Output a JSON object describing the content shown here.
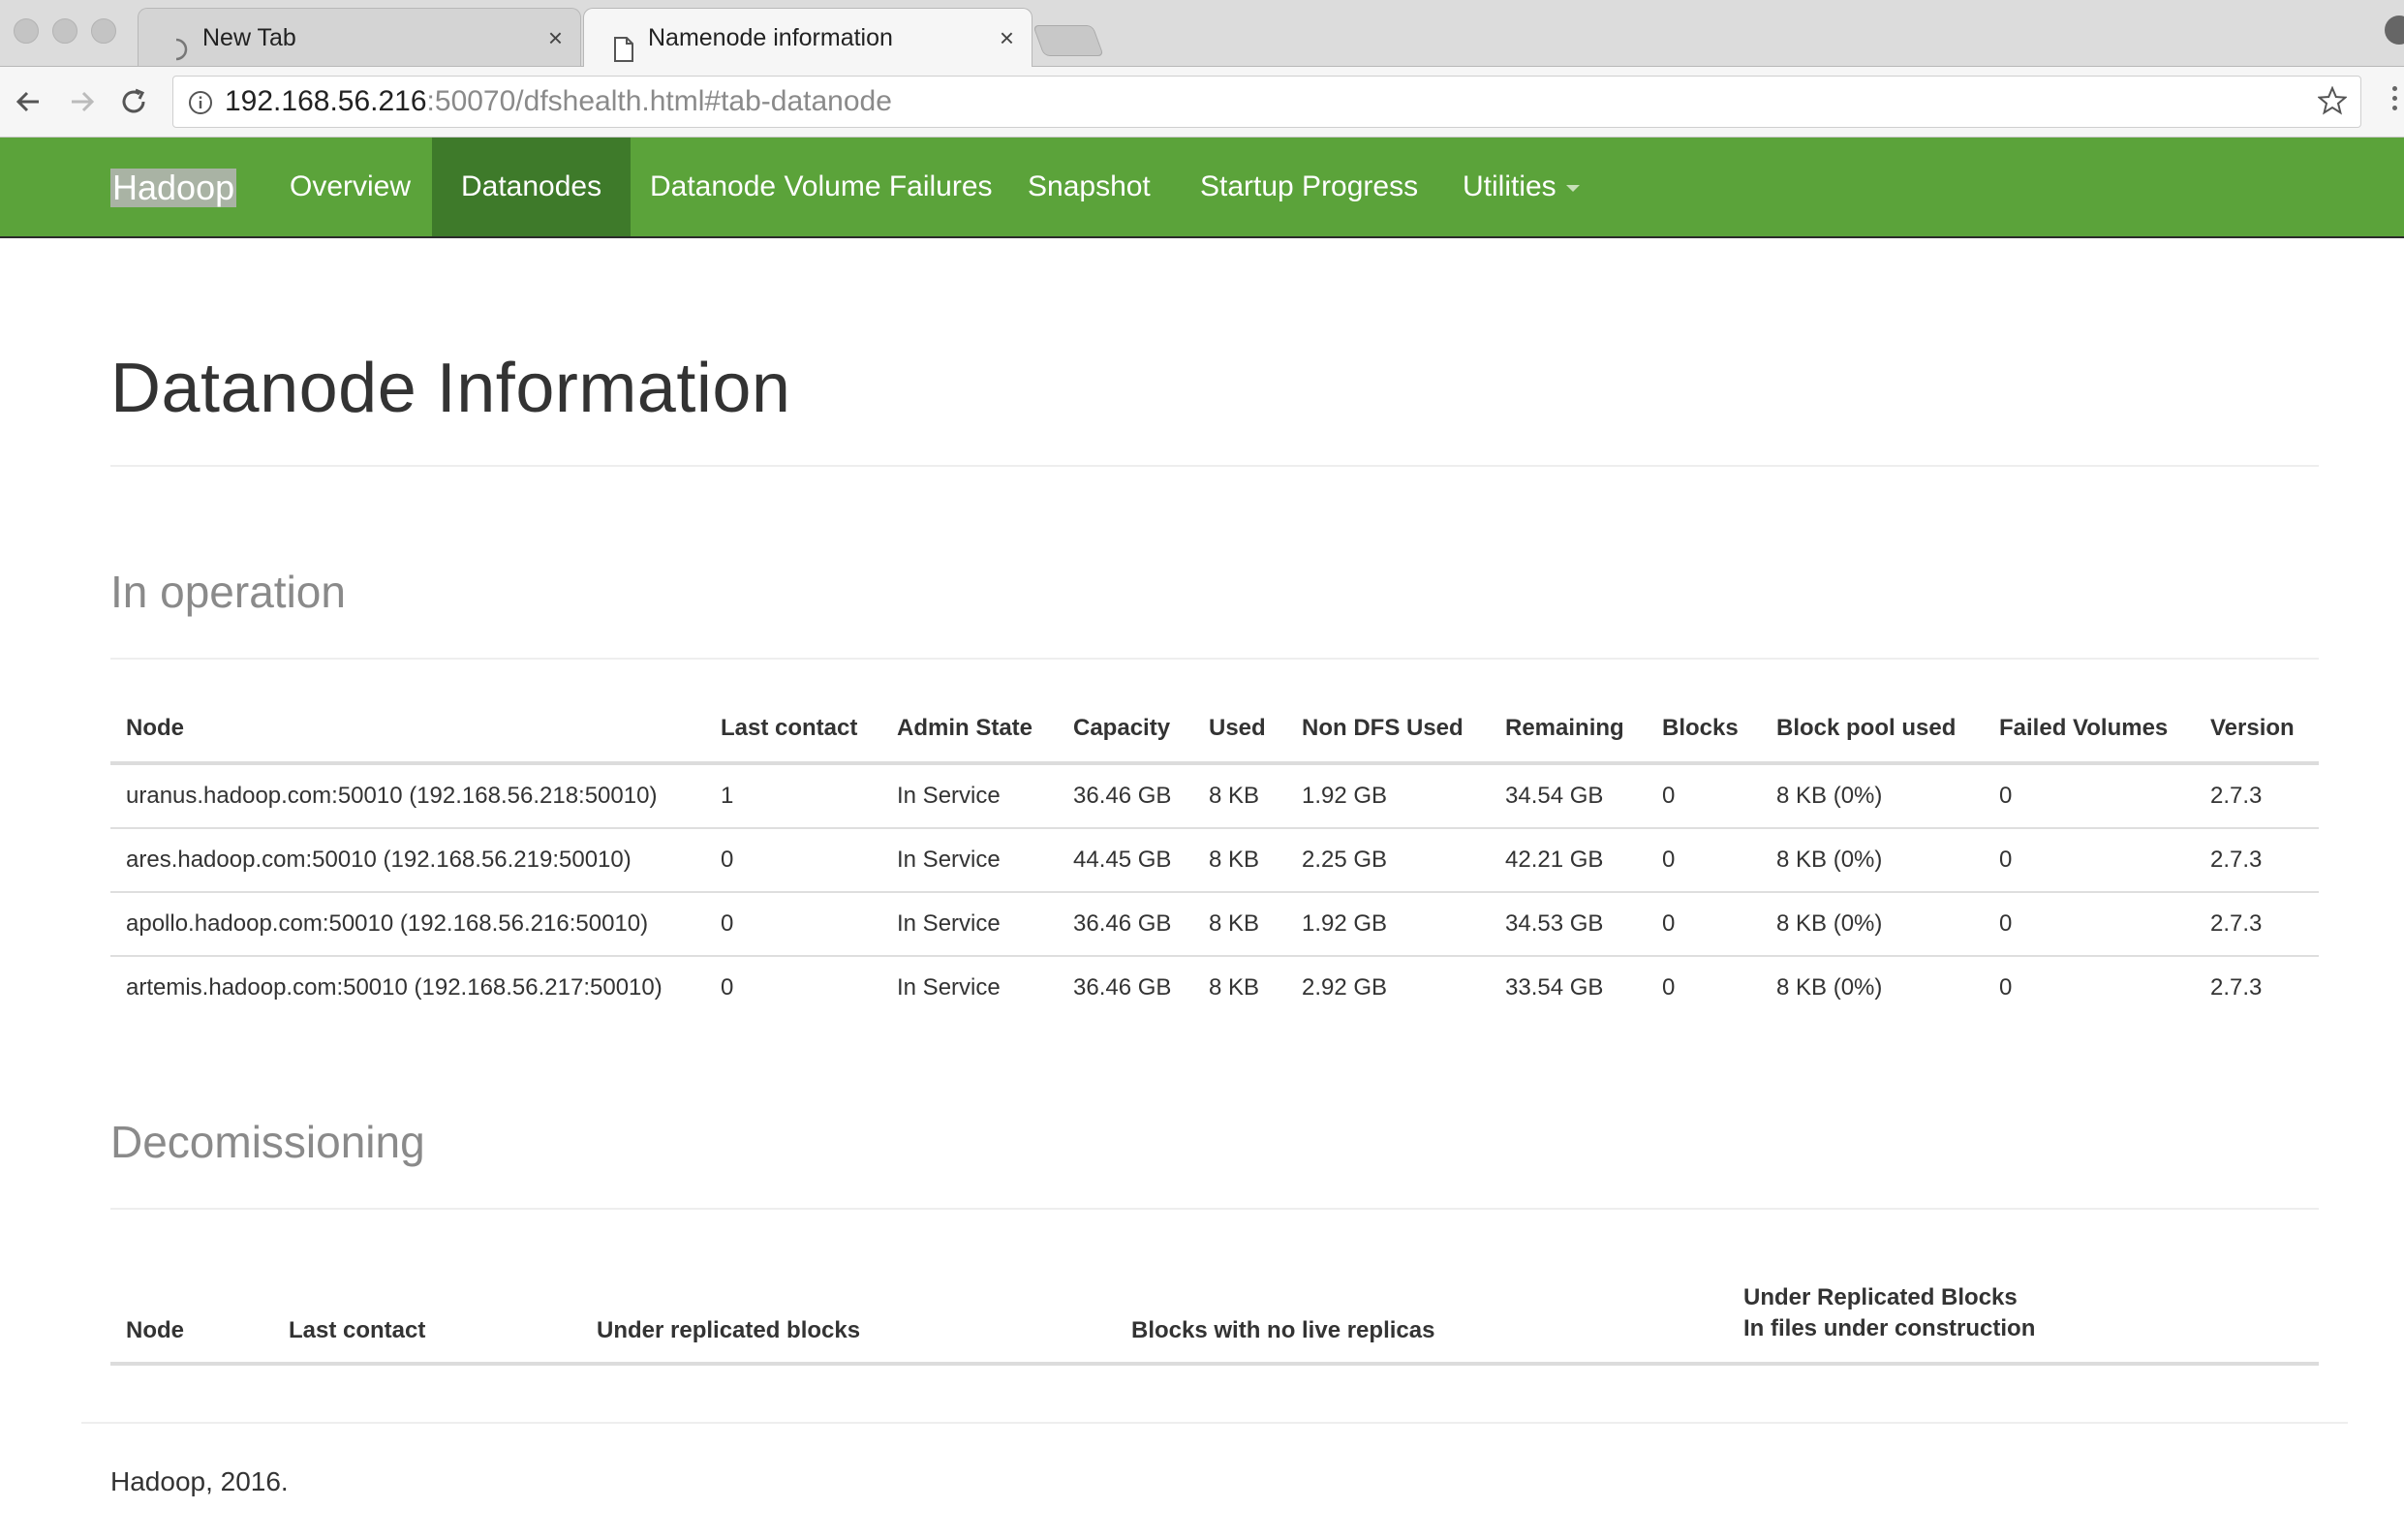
{
  "browser": {
    "tabs": [
      {
        "label": "New Tab",
        "close": "×",
        "active": false
      },
      {
        "label": "Namenode information",
        "close": "×",
        "active": true
      }
    ],
    "url_host": "192.168.56.216",
    "url_rest": ":50070/dfshealth.html#tab-datanode"
  },
  "navbar": {
    "brand": "Hadoop",
    "items": [
      "Overview",
      "Datanodes",
      "Datanode Volume Failures",
      "Snapshot",
      "Startup Progress",
      "Utilities"
    ],
    "active": "Datanodes",
    "accent": "#5ba33a",
    "active_color": "#3e7a2a"
  },
  "page": {
    "title": "Datanode Information"
  },
  "in_operation": {
    "title": "In operation",
    "headers": [
      "Node",
      "Last contact",
      "Admin State",
      "Capacity",
      "Used",
      "Non DFS Used",
      "Remaining",
      "Blocks",
      "Block pool used",
      "Failed Volumes",
      "Version"
    ],
    "rows": [
      [
        "uranus.hadoop.com:50010 (192.168.56.218:50010)",
        "1",
        "In Service",
        "36.46 GB",
        "8 KB",
        "1.92 GB",
        "34.54 GB",
        "0",
        "8 KB (0%)",
        "0",
        "2.7.3"
      ],
      [
        "ares.hadoop.com:50010 (192.168.56.219:50010)",
        "0",
        "In Service",
        "44.45 GB",
        "8 KB",
        "2.25 GB",
        "42.21 GB",
        "0",
        "8 KB (0%)",
        "0",
        "2.7.3"
      ],
      [
        "apollo.hadoop.com:50010 (192.168.56.216:50010)",
        "0",
        "In Service",
        "36.46 GB",
        "8 KB",
        "1.92 GB",
        "34.53 GB",
        "0",
        "8 KB (0%)",
        "0",
        "2.7.3"
      ],
      [
        "artemis.hadoop.com:50010 (192.168.56.217:50010)",
        "0",
        "In Service",
        "36.46 GB",
        "8 KB",
        "2.92 GB",
        "33.54 GB",
        "0",
        "8 KB (0%)",
        "0",
        "2.7.3"
      ]
    ]
  },
  "decommissioning": {
    "title": "Decomissioning",
    "headers": [
      "Node",
      "Last contact",
      "Under replicated blocks",
      "Blocks with no live replicas"
    ],
    "last_header_line1": "Under Replicated Blocks",
    "last_header_line2": "In files under construction"
  },
  "footer": {
    "text": "Hadoop, 2016."
  }
}
